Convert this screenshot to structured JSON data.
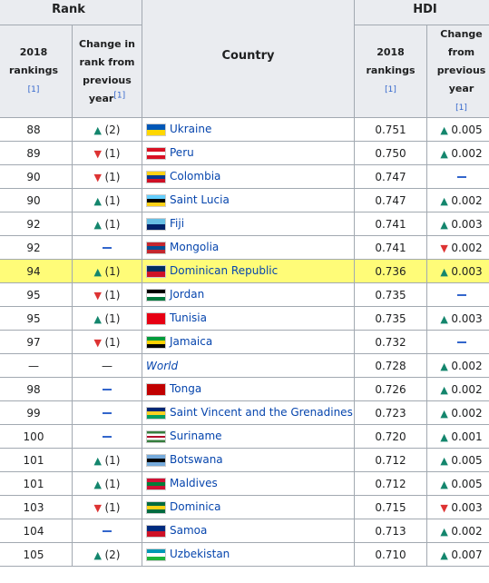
{
  "header": {
    "rank": "Rank",
    "hdi": "HDI",
    "country": "Country",
    "rank_2018": "2018 rankings",
    "rank_change": "Change in rank from previous year",
    "hdi_2018": "2018 rankings",
    "hdi_change": "Change from previous year",
    "ref": "[1]"
  },
  "rows": [
    {
      "rank": "88",
      "rc": "up",
      "rcv": "(2)",
      "country": "Ukraine",
      "flag": [
        "#0057b7",
        "#ffd700"
      ],
      "hdi": "0.751",
      "hc": "up",
      "hcv": "0.005"
    },
    {
      "rank": "89",
      "rc": "down",
      "rcv": "(1)",
      "country": "Peru",
      "flag": [
        "#d91023",
        "#ffffff",
        "#d91023"
      ],
      "hdi": "0.750",
      "hc": "up",
      "hcv": "0.002"
    },
    {
      "rank": "90",
      "rc": "down",
      "rcv": "(1)",
      "country": "Colombia",
      "flag": [
        "#fcd116",
        "#003893",
        "#ce1126"
      ],
      "hdi": "0.747",
      "hc": "dash",
      "hcv": ""
    },
    {
      "rank": "90",
      "rc": "up",
      "rcv": "(1)",
      "country": "Saint Lucia",
      "flag": [
        "#65cfff",
        "#000000",
        "#fcd116"
      ],
      "hdi": "0.747",
      "hc": "up",
      "hcv": "0.002"
    },
    {
      "rank": "92",
      "rc": "up",
      "rcv": "(1)",
      "country": "Fiji",
      "flag": [
        "#68bfe5",
        "#012169"
      ],
      "hdi": "0.741",
      "hc": "up",
      "hcv": "0.003"
    },
    {
      "rank": "92",
      "rc": "dash",
      "rcv": "",
      "country": "Mongolia",
      "flag": [
        "#c4272f",
        "#015197",
        "#c4272f"
      ],
      "hdi": "0.741",
      "hc": "down",
      "hcv": "0.002"
    },
    {
      "rank": "94",
      "rc": "up",
      "rcv": "(1)",
      "country": "Dominican Republic",
      "flag": [
        "#002d62",
        "#ce1126"
      ],
      "hdi": "0.736",
      "hc": "up",
      "hcv": "0.003",
      "hl": true
    },
    {
      "rank": "95",
      "rc": "down",
      "rcv": "(1)",
      "country": "Jordan",
      "flag": [
        "#000000",
        "#ffffff",
        "#007a3d"
      ],
      "hdi": "0.735",
      "hc": "dash",
      "hcv": ""
    },
    {
      "rank": "95",
      "rc": "up",
      "rcv": "(1)",
      "country": "Tunisia",
      "flag": [
        "#e70013",
        "#e70013"
      ],
      "hdi": "0.735",
      "hc": "up",
      "hcv": "0.003"
    },
    {
      "rank": "97",
      "rc": "down",
      "rcv": "(1)",
      "country": "Jamaica",
      "flag": [
        "#009b3a",
        "#fed100",
        "#000000"
      ],
      "hdi": "0.732",
      "hc": "dash",
      "hcv": ""
    },
    {
      "rank": "—",
      "rc": "emdash",
      "rcv": "—",
      "country": "World",
      "italic": true,
      "flag": null,
      "hdi": "0.728",
      "hc": "up",
      "hcv": "0.002"
    },
    {
      "rank": "98",
      "rc": "dash",
      "rcv": "",
      "country": "Tonga",
      "flag": [
        "#c10000",
        "#c10000"
      ],
      "hdi": "0.726",
      "hc": "up",
      "hcv": "0.002"
    },
    {
      "rank": "99",
      "rc": "dash",
      "rcv": "",
      "country": "Saint Vincent and the Grenadines",
      "flag": [
        "#002674",
        "#fcd022",
        "#009e60"
      ],
      "hdi": "0.723",
      "hc": "up",
      "hcv": "0.002"
    },
    {
      "rank": "100",
      "rc": "dash",
      "rcv": "",
      "country": "Suriname",
      "flag": [
        "#377e3f",
        "#ffffff",
        "#b40a2d",
        "#ffffff",
        "#377e3f"
      ],
      "hdi": "0.720",
      "hc": "up",
      "hcv": "0.001"
    },
    {
      "rank": "101",
      "rc": "up",
      "rcv": "(1)",
      "country": "Botswana",
      "flag": [
        "#75aadb",
        "#000000",
        "#75aadb"
      ],
      "hdi": "0.712",
      "hc": "up",
      "hcv": "0.005"
    },
    {
      "rank": "101",
      "rc": "up",
      "rcv": "(1)",
      "country": "Maldives",
      "flag": [
        "#d21034",
        "#007e3a",
        "#d21034"
      ],
      "hdi": "0.712",
      "hc": "up",
      "hcv": "0.005"
    },
    {
      "rank": "103",
      "rc": "down",
      "rcv": "(1)",
      "country": "Dominica",
      "flag": [
        "#006b3f",
        "#fcd116",
        "#006b3f"
      ],
      "hdi": "0.715",
      "hc": "down",
      "hcv": "0.003"
    },
    {
      "rank": "104",
      "rc": "dash",
      "rcv": "",
      "country": "Samoa",
      "flag": [
        "#002b7f",
        "#ce1126"
      ],
      "hdi": "0.713",
      "hc": "up",
      "hcv": "0.002"
    },
    {
      "rank": "105",
      "rc": "up",
      "rcv": "(2)",
      "country": "Uzbekistan",
      "flag": [
        "#0099b5",
        "#ffffff",
        "#1eb53a"
      ],
      "hdi": "0.710",
      "hc": "up",
      "hcv": "0.007"
    }
  ]
}
